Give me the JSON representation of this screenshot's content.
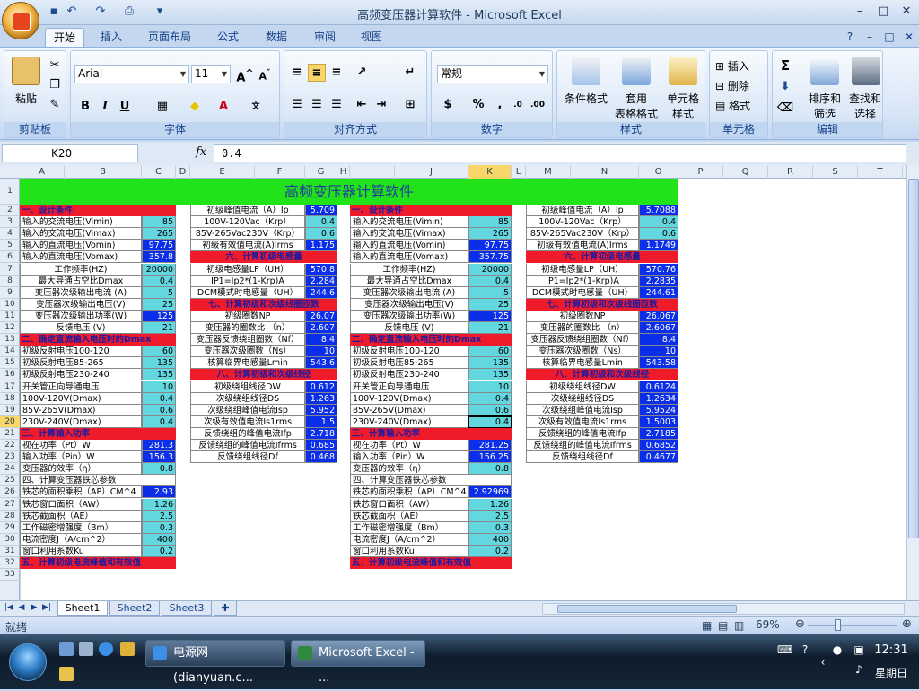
{
  "window": {
    "title": "高频变压器计算软件 - Microsoft Excel"
  },
  "tabs": [
    "开始",
    "插入",
    "页面布局",
    "公式",
    "数据",
    "审阅",
    "视图"
  ],
  "ribbon": {
    "clipboard": {
      "paste": "粘贴",
      "name": "剪贴板"
    },
    "font": {
      "family": "Arial",
      "size": "11",
      "name": "字体"
    },
    "align": {
      "name": "对齐方式"
    },
    "number": {
      "format": "常规",
      "name": "数字"
    },
    "styles": {
      "cond": "条件格式",
      "table": [
        "套用",
        "表格格式"
      ],
      "cell": [
        "单元格",
        "样式"
      ],
      "name": "样式"
    },
    "cells": {
      "insert": "插入",
      "delete": "删除",
      "format": "格式",
      "name": "单元格"
    },
    "edit": {
      "sort": [
        "排序和",
        "筛选"
      ],
      "find": [
        "查找和",
        "选择"
      ],
      "name": "编辑"
    }
  },
  "formula_bar": {
    "name_box": "K20",
    "fx": "fx",
    "value": "0.4"
  },
  "columns": [
    "A",
    "B",
    "C",
    "D",
    "E",
    "F",
    "G",
    "H",
    "I",
    "J",
    "K",
    "L",
    "M",
    "N",
    "O",
    "P",
    "Q",
    "R",
    "S",
    "T"
  ],
  "rows": [
    "1",
    "2",
    "3",
    "4",
    "5",
    "6",
    "7",
    "8",
    "9",
    "10",
    "11",
    "12",
    "13",
    "14",
    "15",
    "16",
    "17",
    "18",
    "19",
    "20",
    "21",
    "22",
    "23",
    "24",
    "25",
    "26",
    "27",
    "28",
    "29",
    "30",
    "31",
    "32",
    "33"
  ],
  "sheet": {
    "title": "高频变压器计算软件",
    "left_labels": [
      "一、设计条件",
      "输入的交流电压(Vimin)",
      "输入的交流电压(Vimax)",
      "输入的直流电压(Vomin)",
      "输入的直流电压(Vomax)",
      "工作频率(HZ)",
      "最大导通占空比Dmax",
      "变压器次级输出电流 (A)",
      "变压器次级输出电压(V)",
      "变压器次级输出功率(W)",
      "反馈电压 (V)",
      "二、确定直流输入电压时的Dmax",
      "初级反射电压100-120",
      "初级反射电压85-265",
      "初级反射电压230-240",
      "开关管正向导通电压",
      "100V-120V(Dmax)",
      "85V-265V(Dmax)",
      "230V-240V(Dmax)",
      "三、计算输入功率",
      "视在功率（Pt）W",
      "输入功率（Pin）W",
      "变压器的效率（η）",
      "四、计算变压器铁芯参数",
      "铁芯的面积乘积（AP）CM^4",
      "铁芯窗口面积（AW）",
      "铁芯截面积（AE）",
      "工作磁密增强度（Bm）",
      "电流密度J（A/cm^2）",
      "窗口利用系数Ku",
      "五、计算初级电流峰值和有效值"
    ],
    "left_values": [
      "",
      "85",
      "265",
      "97.75",
      "357.8",
      "20000",
      "0.4",
      "5",
      "25",
      "125",
      "21",
      "",
      "60",
      "135",
      "135",
      "10",
      "0.4",
      "0.6",
      "0.4",
      "",
      "281.3",
      "156.3",
      "0.8",
      "",
      "2.93",
      "1.26",
      "2.5",
      "0.3",
      "400",
      "0.2",
      ""
    ],
    "right_labels": [
      "一、设计条件",
      "输入的交流电压(Vimin)",
      "输入的交流电压(Vimax)",
      "输入的直流电压(Vomin)",
      "输入的直流电压(Vomax)",
      "工作频率(HZ)",
      "最大导通占空比Dmax",
      "变压器次级输出电流 (A)",
      "变压器次级输出电压(V)",
      "变压器次级输出功率(W)",
      "反馈电压 (V)",
      "二、确定直流输入电压时的Dmax",
      "初级反射电压100-120",
      "初级反射电压85-265",
      "初级反射电压230-240",
      "开关管正向导通电压",
      "100V-120V(Dmax)",
      "85V-265V(Dmax)",
      "230V-240V(Dmax)",
      "三、计算输入功率",
      "视在功率（Pt）W",
      "输入功率（Pin）W",
      "变压器的效率（η）",
      "四、计算变压器铁芯参数",
      "铁芯的面积乘积（AP）CM^4",
      "铁芯窗口面积（AW）",
      "铁芯截面积（AE）",
      "工作磁密增强度（Bm）",
      "电流密度J（A/cm^2）",
      "窗口利用系数Ku",
      "五、计算初级电流峰值和有效值"
    ],
    "right_values": [
      "",
      "85",
      "265",
      "97.75",
      "357.75",
      "20000",
      "0.4",
      "5",
      "25",
      "125",
      "21",
      "",
      "60",
      "135",
      "135",
      "10",
      "0.4",
      "0.6",
      "0.4",
      "",
      "281.25",
      "156.25",
      "0.8",
      "",
      "2.92969",
      "1.26",
      "2.5",
      "0.3",
      "400",
      "0.2",
      ""
    ],
    "mid_labels": [
      "初级峰值电流（A）Ip",
      "100V-120Vac（Krp）",
      "85V-265Vac230V（Krp）",
      "初级有效值电流(A)Irms",
      "六、计算初级电感量",
      "初级电感量LP（UH）",
      "IP1=Ip2*(1-Krp)A",
      "DCM模式时电感量（UH）",
      "七、计算初级和次级线圈匝数",
      "初级圈数NP",
      "变压器的圈数比 （n）",
      "变压器反馈绕组圈数（Nf）",
      "变压器次级圈数（Ns）",
      "核算临界电感量Lmin",
      "八、计算初级和次级线径",
      "初级绕组线径DW",
      "次级绕组线径DS",
      "次级绕组峰值电流Isp",
      "次级有效值电流Is1rms",
      "反馈绕组的峰值电流Ifp",
      "反馈绕组的峰值电流Ifrms",
      "反馈绕组线径Df"
    ],
    "mid_values": [
      "5.709",
      "0.4",
      "0.6",
      "1.175",
      "",
      "570.8",
      "2.284",
      "244.6",
      "",
      "26.07",
      "2.607",
      "8.4",
      "10",
      "543.6",
      "",
      "0.612",
      "1.263",
      "5.952",
      "1.5",
      "2.718",
      "0.685",
      "0.468"
    ],
    "far_labels": [
      "初级峰值电流（A）Ip",
      "100V-120Vac（Krp）",
      "85V-265Vac230V（Krp）",
      "初级有效值电流(A)Irms",
      "六、计算初级电感量",
      "初级电感量LP（UH）",
      "IP1=Ip2*(1-Krp)A",
      "DCM模式时电感量（UH）",
      "七、计算初级和次级线圈匝数",
      "初级圈数NP",
      "变压器的圈数比 （n）",
      "变压器反馈绕组圈数（Nf）",
      "变压器次级圈数（Ns）",
      "核算临界电感量Lmin",
      "八、计算初级和次级线径",
      "初级绕组线径DW",
      "次级绕组线径DS",
      "次级绕组峰值电流Isp",
      "次级有效值电流Is1rms",
      "反馈绕组的峰值电流Ifp",
      "反馈绕组的峰值电流Ifrms",
      "反馈绕组线径Df"
    ],
    "far_values": [
      "5.7088",
      "0.4",
      "0.6",
      "1.1749",
      "",
      "570.76",
      "2.2835",
      "244.61",
      "",
      "26.067",
      "2.6067",
      "8.4",
      "10",
      "543.58",
      "",
      "0.6124",
      "1.2634",
      "5.9524",
      "1.5003",
      "2.7185",
      "0.6852",
      "0.4677"
    ]
  },
  "sheet_tabs": [
    "Sheet1",
    "Sheet2",
    "Sheet3"
  ],
  "status": {
    "text": "就绪",
    "zoom": "69%"
  },
  "taskbar": {
    "items": [
      "电源网 (dianyuan.c...",
      "Microsoft Excel - ..."
    ],
    "time": "12:31",
    "day": "星期日"
  },
  "colors": {
    "header_red": "#ef1b2b",
    "title_green": "#22e21a",
    "input_cyan": "#62d7e0",
    "output_blue": "#0b2ee8"
  }
}
